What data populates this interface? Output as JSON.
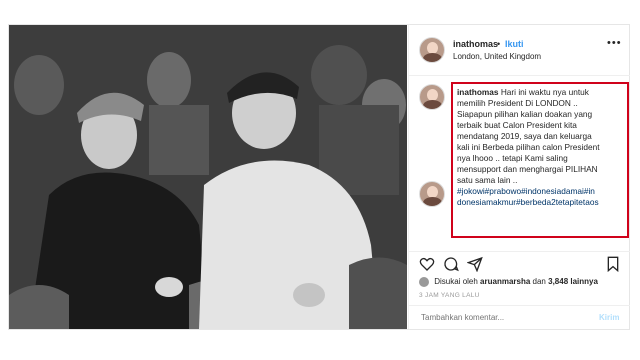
{
  "post": {
    "username": "inathomas",
    "separator": "•",
    "follow_label": "Ikuti",
    "location": "London, United Kingdom",
    "more_label": "•••"
  },
  "caption": {
    "username": "inathomas",
    "lines": [
      "Hari ini waktu nya untuk",
      "memilih President Di LONDON ..",
      "Siapapun pilihan kalian doakan yang",
      "terbaik buat Calon President kita",
      "mendatang 2019, saya dan keluarga",
      "kali ini Berbeda pilihan calon President",
      "nya lhooo .. tetapi Kami saling",
      "mensupport dan menghargai PILIHAN",
      "satu sama lain ..",
      "#jokowi#prabowo#indonesiadamai#in",
      "donesiamakmur#berbeda2tetapitetaos"
    ]
  },
  "likes": {
    "prefix": "Disukai oleh",
    "user": "aruanmarsha",
    "connector": "dan",
    "count": "3,848 lainnya"
  },
  "timestamp": "3 JAM YANG LALU",
  "comment_input": {
    "placeholder": "Tambahkan komentar..."
  },
  "post_button": "Kirim",
  "icons": {
    "like": "heart-icon",
    "comment": "comment-icon",
    "share": "share-icon",
    "save": "bookmark-icon"
  },
  "colors": {
    "link_blue": "#3897f0",
    "highlight_red": "#d0021b",
    "text": "#262626"
  }
}
